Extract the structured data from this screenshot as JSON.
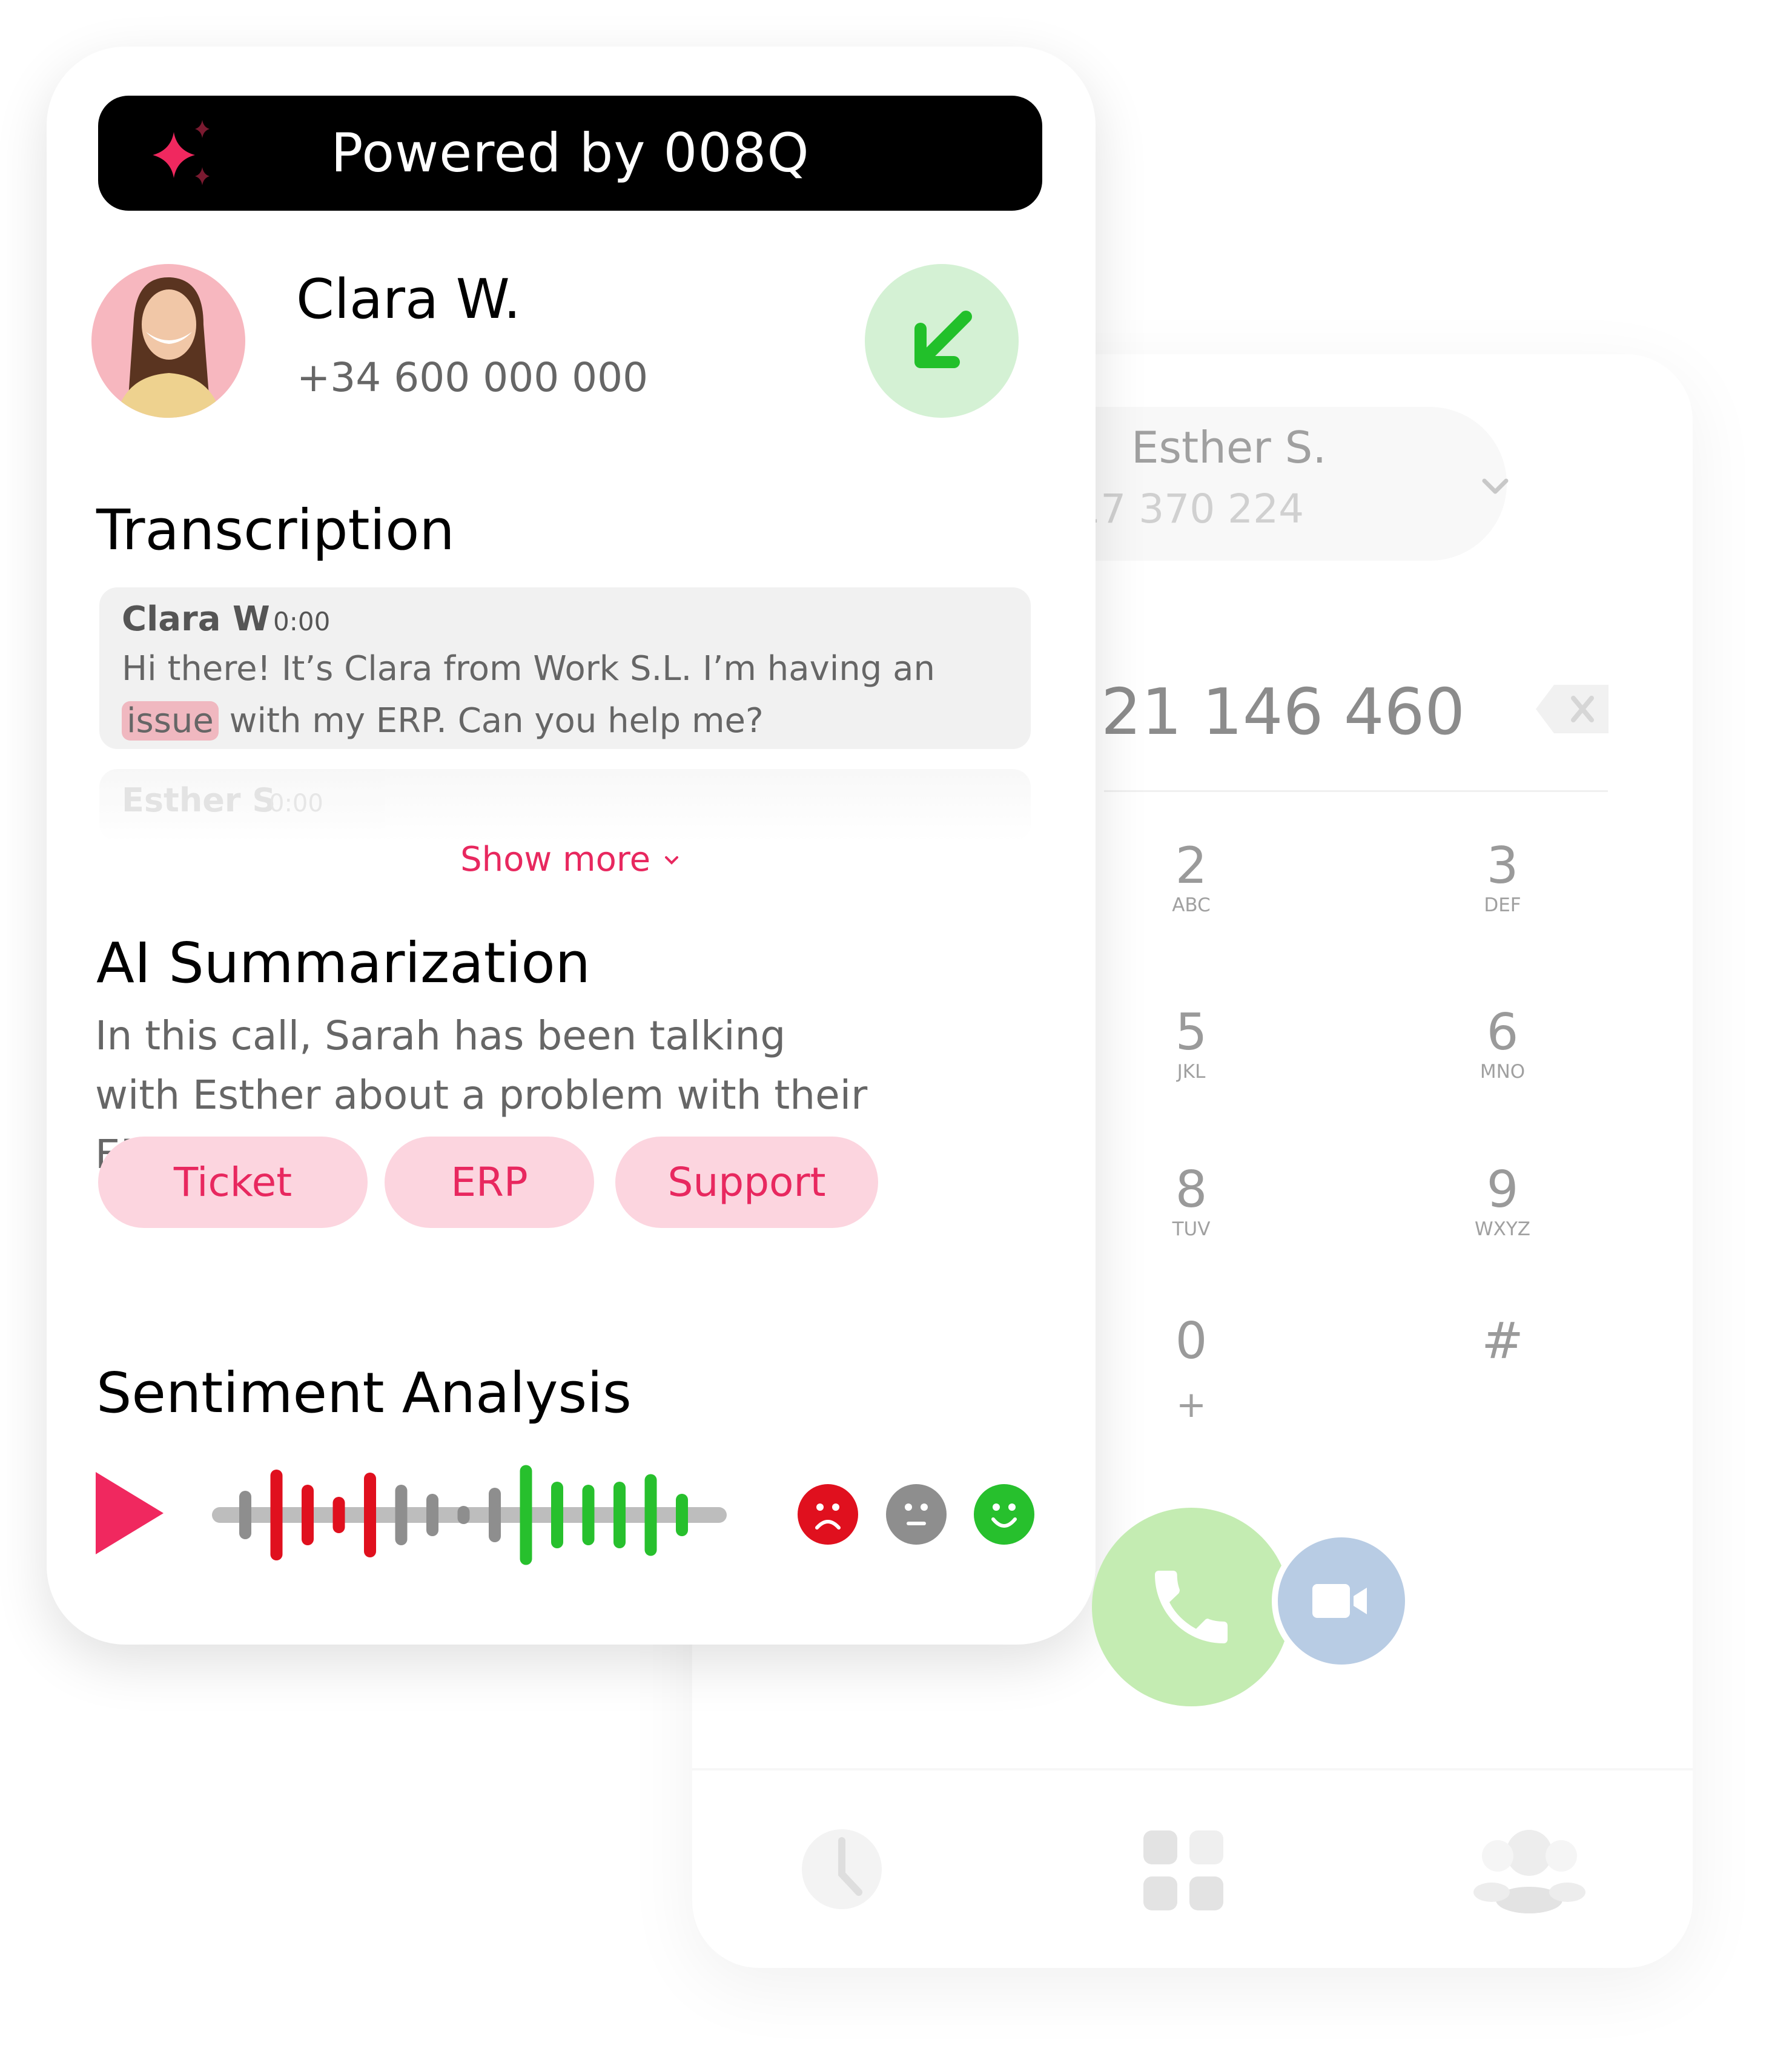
{
  "banner": {
    "label": "Powered by 008Q",
    "icon": "sparkle-icon"
  },
  "caller": {
    "name": "Clara W.",
    "phone": "+34 600 000 000",
    "call_direction_icon": "incoming-arrow-icon"
  },
  "transcription": {
    "title": "Transcription",
    "entries": [
      {
        "speaker": "Clara W",
        "time": "0:00",
        "text_before": "Hi there! It’s Clara from Work S.L. I’m having an ",
        "highlight": "issue",
        "text_after": " with my ERP. Can you help me?"
      },
      {
        "speaker": "Esther S",
        "time": "0:00"
      }
    ],
    "show_more": "Show more"
  },
  "summary": {
    "title": "AI Summarization",
    "text": "In this call, Sarah has been talking with Esther about a problem with their ERP...",
    "tags": [
      "Ticket",
      "ERP",
      "Support"
    ]
  },
  "sentiment": {
    "title": "Sentiment Analysis",
    "faces": [
      "negative",
      "neutral",
      "positive"
    ],
    "colors": {
      "negative": "#e0101e",
      "neutral": "#8e8e8e",
      "positive": "#27c02d"
    }
  },
  "dialer": {
    "contact_name": "Esther S.",
    "contact_phone": "+34 917 370 224",
    "dialed_number": "21 146 460",
    "keys": [
      {
        "digit": "2",
        "letters": "ABC"
      },
      {
        "digit": "3",
        "letters": "DEF"
      },
      {
        "digit": "5",
        "letters": "JKL"
      },
      {
        "digit": "6",
        "letters": "MNO"
      },
      {
        "digit": "8",
        "letters": "TUV"
      },
      {
        "digit": "9",
        "letters": "WXYZ"
      },
      {
        "digit": "0",
        "letters": "+"
      },
      {
        "digit": "#",
        "letters": ""
      }
    ],
    "nav": [
      "clock-icon",
      "grid-icon",
      "contacts-icon"
    ]
  },
  "colors": {
    "accent": "#e8285f",
    "call_green": "#c4ecb2",
    "video_blue": "#b8cce4"
  }
}
